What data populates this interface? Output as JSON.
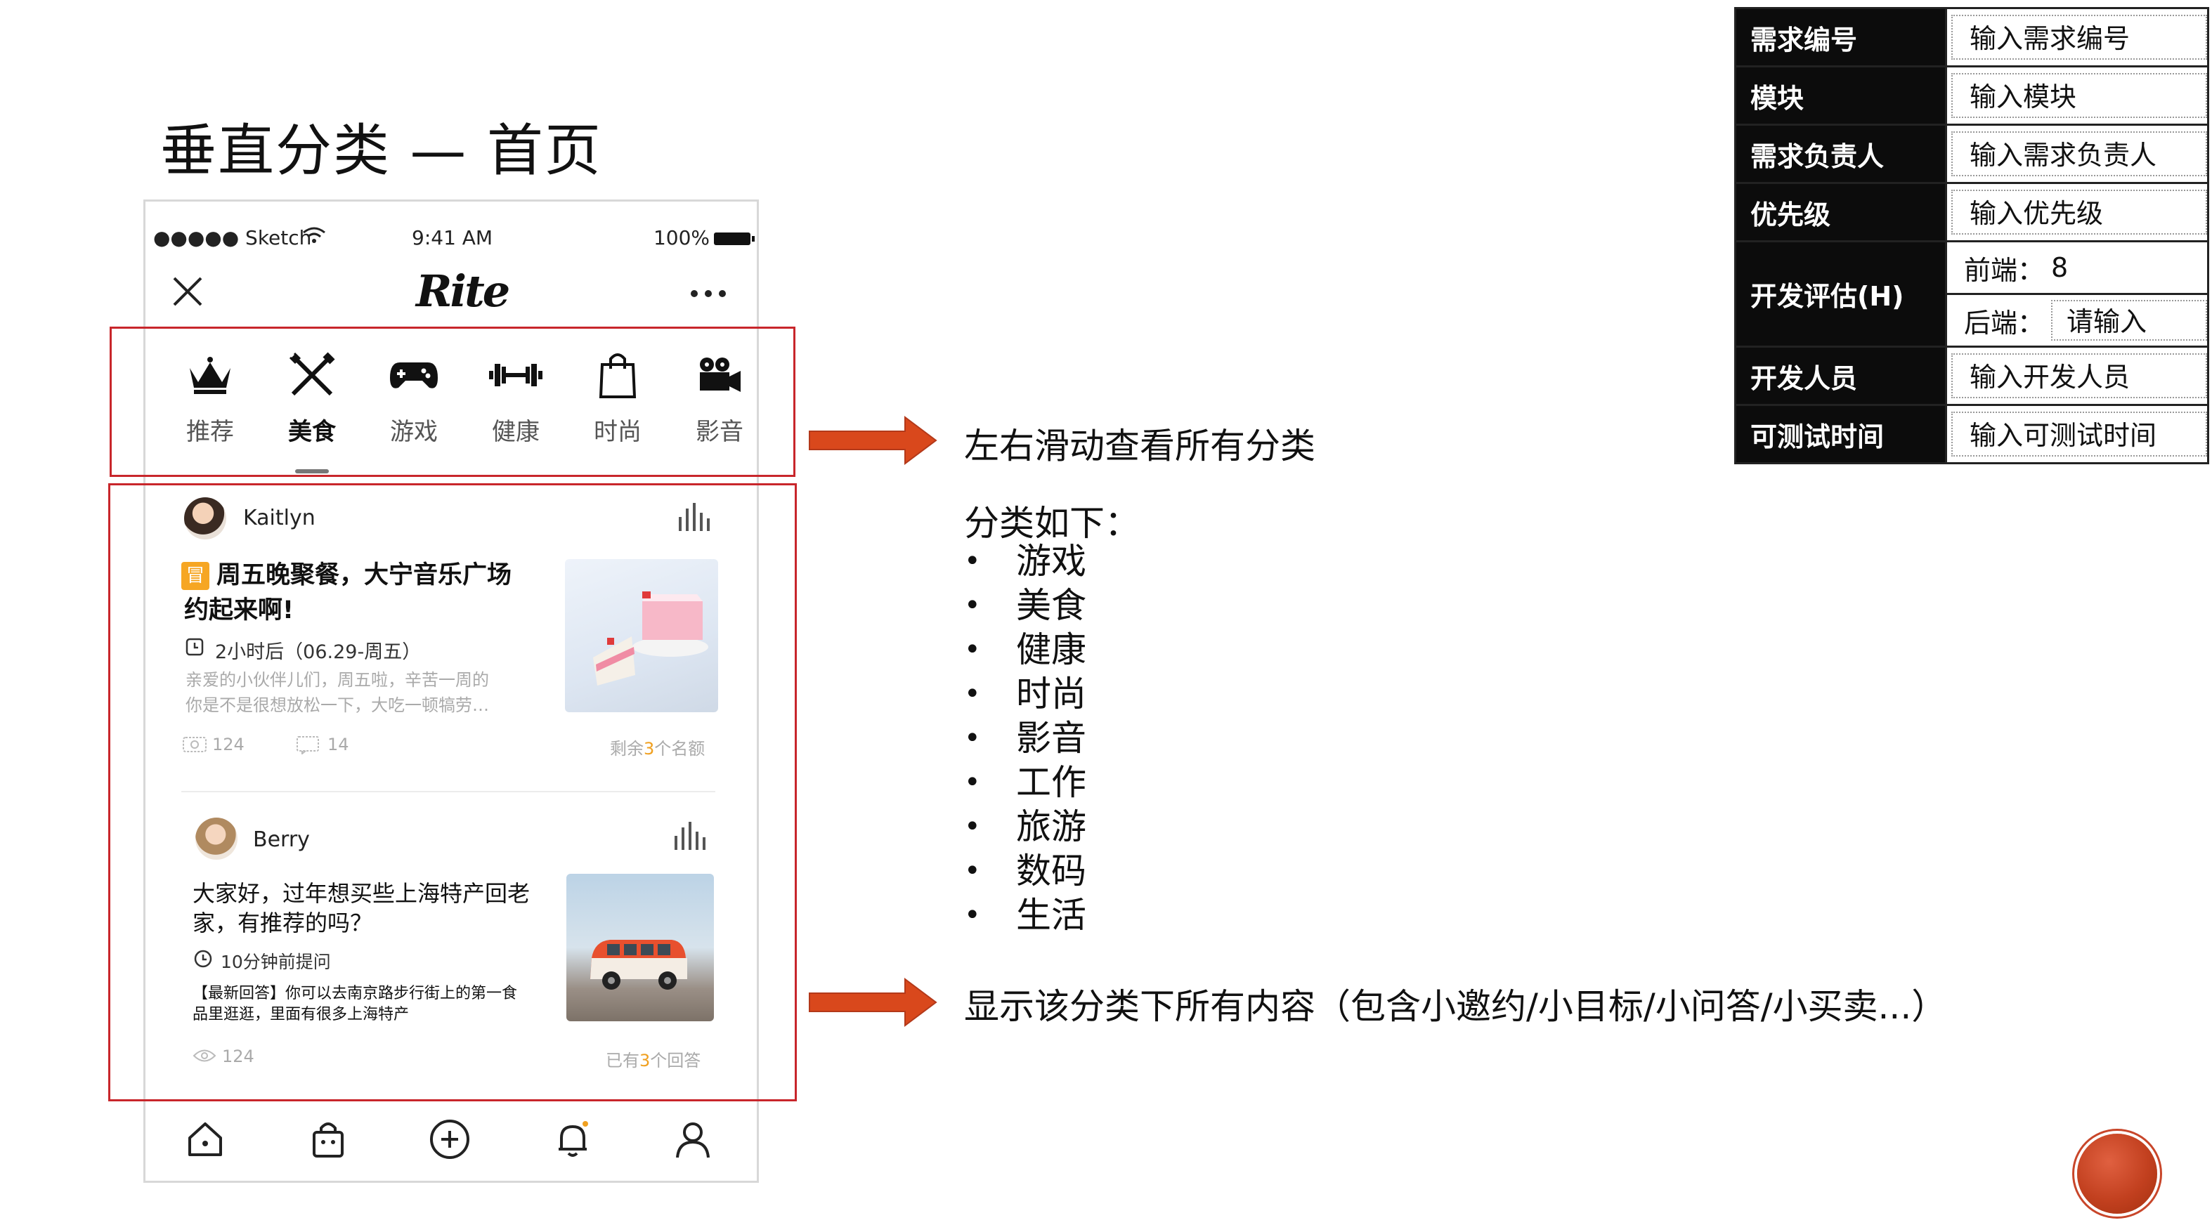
{
  "slide": {
    "title": "垂直分类 — 首页"
  },
  "status_bar": {
    "carrier": "●●●●● Sketch",
    "time": "9:41 AM",
    "battery": "100%"
  },
  "app": {
    "logo": "Rite"
  },
  "categories": [
    {
      "label": "推荐",
      "icon": "crown-icon",
      "active": false
    },
    {
      "label": "美食",
      "icon": "fork-knife-icon",
      "active": true
    },
    {
      "label": "游戏",
      "icon": "gamepad-icon",
      "active": false
    },
    {
      "label": "健康",
      "icon": "dumbbell-icon",
      "active": false
    },
    {
      "label": "时尚",
      "icon": "shopping-bag-icon",
      "active": false
    },
    {
      "label": "影音",
      "icon": "video-camera-icon",
      "active": false
    }
  ],
  "posts": [
    {
      "user": "Kaitlyn",
      "tag": "冒",
      "title_line1": "周五晚聚餐，大宁音乐广场",
      "title_line2": "约起来啊!",
      "time": "2小时后（06.29-周五）",
      "desc_line1": "亲爱的小伙伴儿们，周五啦，辛苦一周的",
      "desc_line2": "你是不是很想放松一下，大吃一顿犒劳…",
      "views": "124",
      "comments": "14",
      "quota_prefix": "剩余",
      "quota_num": "3",
      "quota_suffix": "个名额"
    },
    {
      "user": "Berry",
      "title_line1": "大家好，过年想买些上海特产回老",
      "title_line2": "家，有推荐的吗？",
      "time": "10分钟前提问",
      "desc_line1": "【最新回答】你可以去南京路步行街上的第一食",
      "desc_line2": "品里逛逛，里面有很多上海特产",
      "views": "124",
      "quota_prefix": "已有",
      "quota_num": "3",
      "quota_suffix": "个回答"
    }
  ],
  "bottom_nav": [
    "home-icon",
    "bag-icon",
    "add-icon",
    "bell-icon",
    "profile-icon"
  ],
  "annotations": {
    "swipe": "左右滑动查看所有分类",
    "list_title": "分类如下：",
    "list": [
      "游戏",
      "美食",
      "健康",
      "时尚",
      "影音",
      "工作",
      "旅游",
      "数码",
      "生活"
    ],
    "show_all": "显示该分类下所有内容（包含小邀约/小目标/小问答/小买卖...）"
  },
  "info_table": {
    "req_id_label": "需求编号",
    "req_id_value": "输入需求编号",
    "module_label": "模块",
    "module_value": "输入模块",
    "owner_label": "需求负责人",
    "owner_value": "输入需求负责人",
    "priority_label": "优先级",
    "priority_value": "输入优先级",
    "estimate_label": "开发评估(H)",
    "frontend_label": "前端：",
    "frontend_value": "8",
    "backend_label": "后端：",
    "backend_value": "请输入",
    "dev_label": "开发人员",
    "dev_value": "输入开发人员",
    "test_label": "可测试时间",
    "test_value": "输入可测试时间"
  },
  "colors": {
    "highlight": "#c8262b",
    "arrow": "#d9481c",
    "accent": "#f0a020"
  }
}
